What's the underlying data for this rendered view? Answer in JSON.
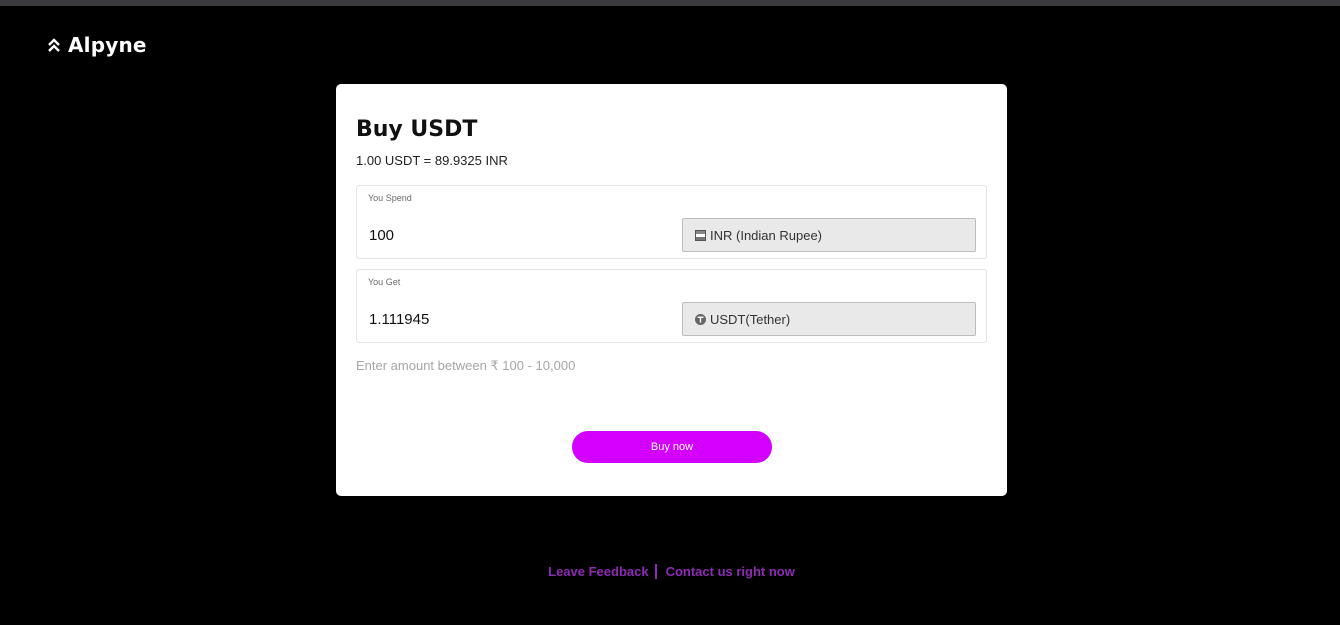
{
  "brand": {
    "name": "Alpyne",
    "icon": "double-chevron-up-icon"
  },
  "card": {
    "title": "Buy USDT",
    "rate": "1.00 USDT = 89.9325 INR",
    "spend": {
      "label": "You Spend",
      "value": "100",
      "currency": "INR (Indian Rupee)",
      "currency_icon": "india-flag-icon"
    },
    "get": {
      "label": "You Get",
      "value": "1.111945",
      "currency": "USDT(Tether)",
      "currency_icon": "tether-icon"
    },
    "hint": "Enter amount between ₹ 100 - 10,000",
    "buy_label": "Buy now"
  },
  "footer": {
    "feedback_label": "Leave Feedback",
    "contact_label": "Contact us right now"
  },
  "colors": {
    "background": "#000000",
    "card": "#ffffff",
    "accent": "#d400ff",
    "footer_link": "#8e2ab5"
  }
}
